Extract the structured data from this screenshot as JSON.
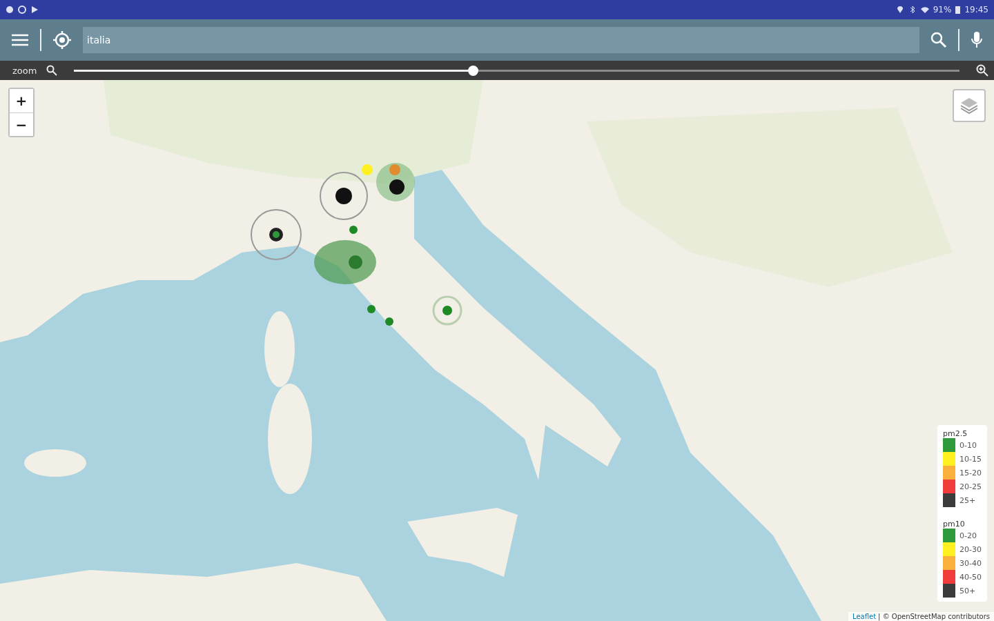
{
  "status_bar": {
    "battery": "91%",
    "time": "19:45"
  },
  "search": {
    "value": "italia"
  },
  "zoom_bar": {
    "label": "zoom",
    "level": 0.45
  },
  "map": {
    "kind": "picture",
    "zoom_in": "+",
    "zoom_out": "−",
    "legend": [
      {
        "title": "pm2.5",
        "items": [
          {
            "label": "0-10",
            "color": "#2e9a3c"
          },
          {
            "label": "10-15",
            "color": "#fff021"
          },
          {
            "label": "15-20",
            "color": "#fbb03b"
          },
          {
            "label": "20-25",
            "color": "#f23c3c"
          },
          {
            "label": "25+",
            "color": "#3b3b3b"
          }
        ]
      },
      {
        "title": "pm10",
        "items": [
          {
            "label": "0-20",
            "color": "#2e9a3c"
          },
          {
            "label": "20-30",
            "color": "#fff021"
          },
          {
            "label": "30-40",
            "color": "#fbb03b"
          },
          {
            "label": "40-50",
            "color": "#f23c3c"
          },
          {
            "label": "50+",
            "color": "#3b3b3b"
          }
        ]
      }
    ],
    "attribution": {
      "link": "Leaflet",
      "text": "| © OpenStreetMap contributors"
    }
  }
}
